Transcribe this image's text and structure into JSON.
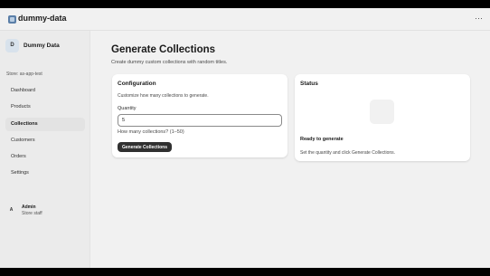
{
  "app": {
    "name": "dummy-data",
    "more_label": "···"
  },
  "sidebar": {
    "store_initial": "D",
    "store_name": "Dummy Data",
    "store_line": "Store: as-app-test",
    "items": [
      {
        "label": "Dashboard",
        "active": false
      },
      {
        "label": "Products",
        "active": false
      },
      {
        "label": "Collections",
        "active": true
      },
      {
        "label": "Customers",
        "active": false
      },
      {
        "label": "Orders",
        "active": false
      },
      {
        "label": "Settings",
        "active": false
      }
    ],
    "user": {
      "initial": "A",
      "name": "Admin",
      "role": "Store staff"
    }
  },
  "main": {
    "title": "Generate Collections",
    "subtitle": "Create dummy custom collections with random titles."
  },
  "config": {
    "title": "Configuration",
    "description": "Customize how many collections to generate.",
    "quantity_label": "Quantity",
    "quantity_value": "5",
    "help": "How many collections? (1–50)",
    "button_label": "Generate Collections"
  },
  "status": {
    "title": "Status",
    "heading": "Ready to generate",
    "description": "Set the quantity and click Generate Collections."
  }
}
